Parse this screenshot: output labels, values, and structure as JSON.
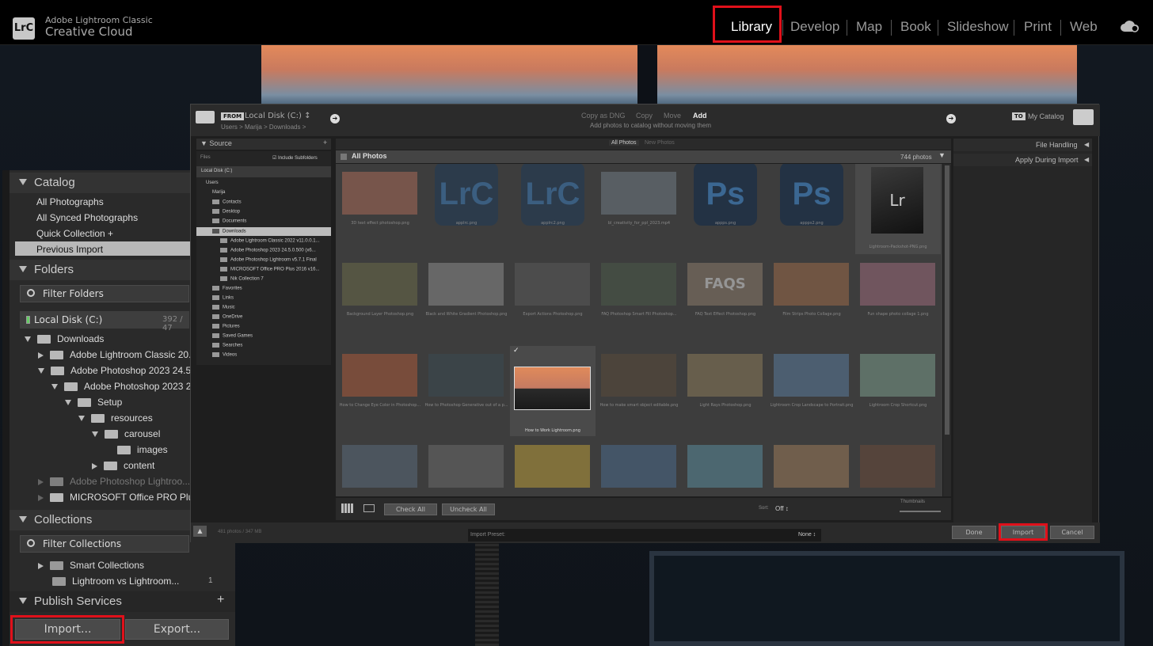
{
  "app": {
    "logo_text": "LrC",
    "brand_line1": "Adobe Lightroom Classic",
    "brand_line2": "Creative Cloud",
    "cloud_icon": "cloud-sync-icon"
  },
  "modules": [
    "Library",
    "Develop",
    "Map",
    "Book",
    "Slideshow",
    "Print",
    "Web"
  ],
  "active_module": "Library",
  "left_panel": {
    "catalog": {
      "title": "Catalog",
      "items": [
        "All Photographs",
        "All Synced Photographs",
        "Quick Collection  +",
        "Previous Import"
      ],
      "selected": "Previous Import"
    },
    "folders": {
      "title": "Folders",
      "filter_placeholder": "Filter Folders",
      "volume": {
        "name": "Local Disk (C:)",
        "stats": "392 / 47"
      },
      "tree": [
        {
          "label": "Downloads"
        },
        {
          "label": "Adobe Lightroom Classic 20..."
        },
        {
          "label": "Adobe Photoshop 2023 24.5..."
        },
        {
          "label": "Adobe Photoshop 2023 2..."
        },
        {
          "label": "Setup"
        },
        {
          "label": "resources"
        },
        {
          "label": "carousel"
        },
        {
          "label": "images"
        },
        {
          "label": "content"
        },
        {
          "label": "Adobe Photoshop Lightroo..."
        },
        {
          "label": "MICROSOFT Office PRO Plu..."
        }
      ]
    },
    "collections": {
      "title": "Collections",
      "filter_placeholder": "Filter Collections",
      "items": [
        {
          "label": "Smart Collections",
          "count": ""
        },
        {
          "label": "Lightroom vs Lightroom...",
          "count": "1"
        }
      ]
    },
    "publish": {
      "title": "Publish Services",
      "add_icon": "+"
    },
    "import_button": "Import...",
    "export_button": "Export..."
  },
  "import_dialog": {
    "from_badge": "FROM",
    "source_name": "Local Disk (C:)",
    "source_arrow": "↕",
    "source_path": "Users > Marija > Downloads >",
    "modes": [
      "Copy as DNG",
      "Copy",
      "Move",
      "Add"
    ],
    "active_mode": "Add",
    "mode_hint": "Add photos to catalog without moving them",
    "to_badge": "TO",
    "dest_name": "My Catalog",
    "source_panel": {
      "title": "Source",
      "add": "+",
      "files_label": "Files",
      "include_subfolders": "Include Subfolders",
      "volume": "Local Disk (C:)",
      "tree": [
        "Users",
        "Marija",
        "Contacts",
        "Desktop",
        "Documents",
        "Downloads",
        "Adobe Lightroom Classic 2022 v11.0.0.1...",
        "Adobe Photoshop 2023 24.5.0.500 (x6...",
        "Adobe Photoshop Lightroom v5.7.1 Final",
        "MICROSOFT Office PRO Plus 2016 v16...",
        "Nik Collection 7",
        "Favorites",
        "Links",
        "Music",
        "OneDrive",
        "Pictures",
        "Saved Games",
        "Searches",
        "Videos"
      ]
    },
    "filter_tabs": [
      "All Photos",
      "New Photos"
    ],
    "grid_title": "All Photos",
    "grid_count": "744 photos",
    "thumbnails": [
      {
        "caption": "3D text effect photoshop.png",
        "type": "photo",
        "color": "#a86a58"
      },
      {
        "caption": "applrc.png",
        "type": "lrc",
        "color": "#1f3a58"
      },
      {
        "caption": "applrc2.png",
        "type": "lrc",
        "color": "#1f3a58"
      },
      {
        "caption": "bl_creativity_for_ppl_2023.mp4",
        "type": "photo",
        "color": "#707a84"
      },
      {
        "caption": "appps.png",
        "type": "ps",
        "color": "#0f2a4a"
      },
      {
        "caption": "appps2.png",
        "type": "ps",
        "color": "#0f2a4a"
      },
      {
        "caption": "Lightroom-Packshot-PNG.png",
        "type": "box",
        "color": "#2a2a2a"
      },
      {
        "caption": "Background Layer Photoshop.png",
        "type": "photo",
        "color": "#6a6a48"
      },
      {
        "caption": "Black and White Gradient Photoshop.png",
        "type": "photo",
        "color": "#8a8a8a"
      },
      {
        "caption": "Export Actions Photoshop.png",
        "type": "photo",
        "color": "#5a5a5a"
      },
      {
        "caption": "FAQ Photoshop Smart Fill Photoshop...",
        "type": "photo",
        "color": "#4a5a48"
      },
      {
        "caption": "FAQ Text Effect Photoshop.png",
        "type": "faqs",
        "color": "#8a7a6a"
      },
      {
        "caption": "Film Strips Photo Collage.png",
        "type": "photo",
        "color": "#9a6a48"
      },
      {
        "caption": "Fun shape photo collage 1.png",
        "type": "photo",
        "color": "#9a6a7a"
      },
      {
        "caption": "How to Change Eye Color in Photoshop...",
        "type": "photo",
        "color": "#aa5a3a"
      },
      {
        "caption": "How to Photoshop Generative out of a p...",
        "type": "photo",
        "color": "#3a4a52"
      },
      {
        "caption": "How to Work Lightroom.png",
        "type": "selected",
        "color": "#e08a5a"
      },
      {
        "caption": "How to make smart object editable.png",
        "type": "photo",
        "color": "#5a4a3a"
      },
      {
        "caption": "Light Rays Photoshop.png",
        "type": "photo",
        "color": "#8a7a5a"
      },
      {
        "caption": "Lightroom Crop Landscape to Portrait.png",
        "type": "photo",
        "color": "#5a7a9a"
      },
      {
        "caption": "Lightroom Crop Shortcut.png",
        "type": "photo",
        "color": "#7a9a8a"
      },
      {
        "caption": "",
        "type": "photo",
        "color": "#5a6a7a"
      },
      {
        "caption": "",
        "type": "photo",
        "color": "#6a6a6a"
      },
      {
        "caption": "",
        "type": "photo",
        "color": "#b89a3a"
      },
      {
        "caption": "",
        "type": "photo",
        "color": "#4a6a8a"
      },
      {
        "caption": "",
        "type": "photo",
        "color": "#5a8a9a"
      },
      {
        "caption": "",
        "type": "photo",
        "color": "#9a7a5a"
      },
      {
        "caption": "",
        "type": "photo",
        "color": "#6a4a3a"
      }
    ],
    "check_all": "Check All",
    "uncheck_all": "Uncheck All",
    "sort_label": "Sort:",
    "sort_value": "Off ↕",
    "thumbnails_label": "Thumbnails",
    "right_panel": [
      "File Handling",
      "Apply During Import"
    ],
    "status": "481 photos / 347 MB",
    "preset_label": "Import Preset:",
    "preset_value": "None ↕",
    "done": "Done",
    "import": "Import",
    "cancel": "Cancel"
  },
  "colors": {
    "highlight": "#e0101a",
    "panel": "#2a2a2a",
    "accent_selected": "#9a9a9a"
  }
}
